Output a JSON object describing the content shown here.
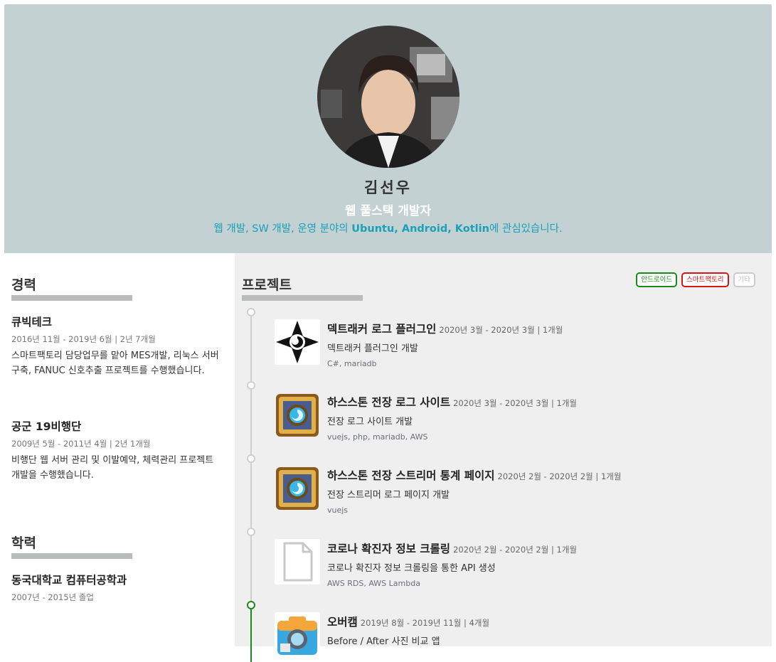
{
  "profile": {
    "name": "김선우",
    "role": "웹 풀스택 개발자",
    "intro_prefix": "웹 개발, SW 개발, 운영 분야의 ",
    "intro_tech": "Ubuntu, Android, Kotlin",
    "intro_suffix": "에 관심있습니다."
  },
  "career": {
    "title": "경력",
    "items": [
      {
        "company": "큐빅테크",
        "period": "2016년 11월 - 2019년 6월 | 2년 7개월",
        "desc": "스마트팩토리 담당업무를 맡아 MES개발, 리눅스 서버구축, FANUC 신호추출 프로젝트를 수행했습니다."
      },
      {
        "company": "공군 19비행단",
        "period": "2009년 5월 - 2011년 4월 | 2년 1개월",
        "desc": "비행단 웹 서버 관리 및 이발예약, 체력관리 프로젝트 개발을 수행했습니다."
      }
    ]
  },
  "education": {
    "title": "학력",
    "school": "동국대학교 컴퓨터공학과",
    "period": "2007년 - 2015년 졸업"
  },
  "projects": {
    "title": "프로젝트",
    "filters": {
      "android": "안드로이드",
      "smart": "스마트팩토리",
      "etc": "기타"
    },
    "items": [
      {
        "icon": "hearthstone-tracker-icon",
        "title": "덱트래커 로그 플러그인",
        "period": "2020년 3월 - 2020년 3월 | 1개월",
        "desc": "덱트래커 플러그인 개발",
        "stack": "C#, mariadb"
      },
      {
        "icon": "hearthstone-logo-icon",
        "title": "하스스톤 전장 로그 사이트",
        "period": "2020년 3월 - 2020년 3월 | 1개월",
        "desc": "전장 로그 사이트 개발",
        "stack": "vuejs, php, mariadb, AWS"
      },
      {
        "icon": "hearthstone-logo-icon",
        "title": "하스스톤 전장 스트리머 통계 페이지",
        "period": "2020년 2월 - 2020년 2월 | 1개월",
        "desc": "전장 스트리머 로그 페이지 개발",
        "stack": "vuejs"
      },
      {
        "icon": "file-icon",
        "title": "코로나 확진자 정보 크롤링",
        "period": "2020년 2월 - 2020년 2월 | 1개월",
        "desc": "코로나 확진자 정보 크롤링을 통한 API 생성",
        "stack": "AWS RDS, AWS Lambda"
      },
      {
        "icon": "camera-app-icon",
        "title": "오버캠",
        "period": "2019년 8월 - 2019년 11월 | 4개월",
        "desc": "Before / After 사진 비교 앱",
        "stack": ""
      }
    ]
  },
  "colors": {
    "header_bg": "#c3d1d3",
    "accent_teal": "#1aa0b8",
    "android_green": "#1a8a1a",
    "smart_red": "#d01818"
  }
}
